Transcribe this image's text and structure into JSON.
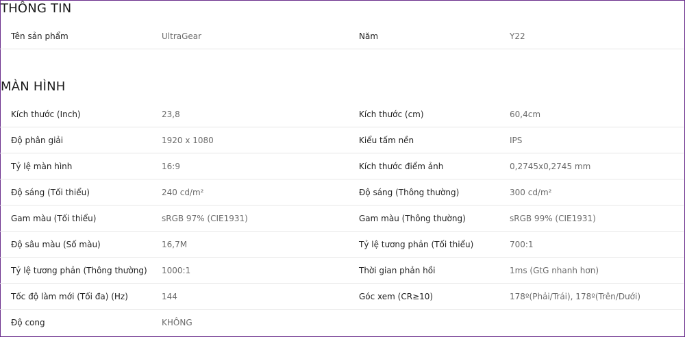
{
  "sections": [
    {
      "title": "THÔNG TIN",
      "rows": [
        {
          "l1": "Tên sản phẩm",
          "v1": "UltraGear",
          "l2": "Năm",
          "v2": "Y22"
        }
      ]
    },
    {
      "title": "MÀN HÌNH",
      "rows": [
        {
          "l1": "Kích thước (Inch)",
          "v1": "23,8",
          "l2": "Kích thước (cm)",
          "v2": "60,4cm"
        },
        {
          "l1": "Độ phân giải",
          "v1": "1920 x 1080",
          "l2": "Kiểu tấm nền",
          "v2": "IPS"
        },
        {
          "l1": "Tỷ lệ màn hình",
          "v1": "16:9",
          "l2": "Kích thước điểm ảnh",
          "v2": "0,2745x0,2745 mm"
        },
        {
          "l1": "Độ sáng (Tối thiểu)",
          "v1": "240 cd/m²",
          "l2": "Độ sáng (Thông thường)",
          "v2": "300 cd/m²"
        },
        {
          "l1": "Gam màu (Tối thiểu)",
          "v1": "sRGB 97% (CIE1931)",
          "l2": "Gam màu (Thông thường)",
          "v2": "sRGB 99% (CIE1931)"
        },
        {
          "l1": "Độ sâu màu (Số màu)",
          "v1": "16,7M",
          "l2": "Tỷ lệ tương phản (Tối thiểu)",
          "v2": "700:1"
        },
        {
          "l1": "Tỷ lệ tương phản (Thông thường)",
          "v1": "1000:1",
          "l2": "Thời gian phản hồi",
          "v2": "1ms (GtG nhanh hơn)"
        },
        {
          "l1": "Tốc độ làm mới (Tối đa) (Hz)",
          "v1": "144",
          "l2": "Góc xem (CR≥10)",
          "v2": "178º(Phải/Trái), 178º(Trên/Dưới)"
        },
        {
          "l1": "Độ cong",
          "v1": "KHÔNG",
          "l2": "",
          "v2": ""
        }
      ]
    }
  ],
  "colors": {
    "frame_border": "#6a2c8c",
    "label": "#222222",
    "value": "#6b6b6b",
    "divider": "#e6e6e6"
  }
}
